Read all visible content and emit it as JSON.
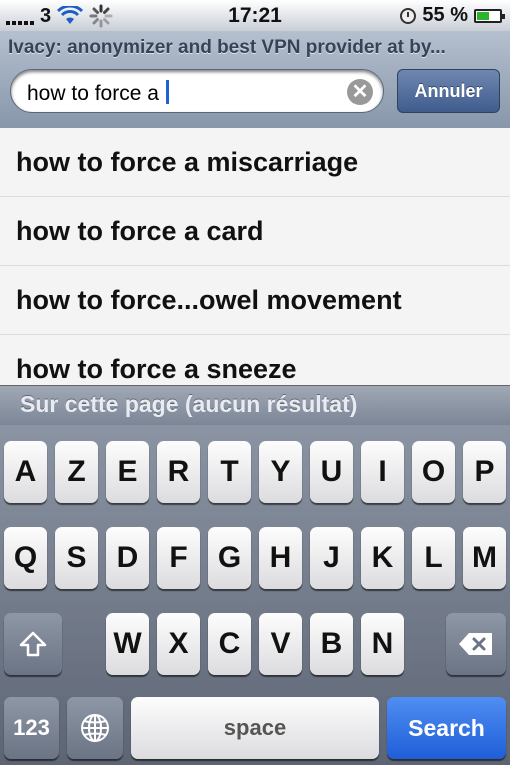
{
  "status_bar": {
    "carrier": "3",
    "time": "17:21",
    "battery_percent": "55 %",
    "battery_level": 0.55
  },
  "header": {
    "page_title": "Ivacy: anonymizer and best VPN provider at by...",
    "search_value": "how to force a",
    "cancel_label": "Annuler"
  },
  "suggestions": [
    "how to force a miscarriage",
    "how to force a card",
    "how to force...owel movement",
    "how to force a sneeze"
  ],
  "find_on_page": "Sur cette page (aucun résultat)",
  "keyboard": {
    "row1": [
      "A",
      "Z",
      "E",
      "R",
      "T",
      "Y",
      "U",
      "I",
      "O",
      "P"
    ],
    "row2": [
      "Q",
      "S",
      "D",
      "F",
      "G",
      "H",
      "J",
      "K",
      "L",
      "M"
    ],
    "row3": [
      "W",
      "X",
      "C",
      "V",
      "B",
      "N"
    ],
    "numbers_label": "123",
    "space_label": "space",
    "search_label": "Search"
  },
  "icons": [
    "signal-icon",
    "wifi-icon",
    "activity-spinner-icon",
    "clock-icon",
    "battery-icon",
    "clear-icon",
    "shift-icon",
    "globe-icon",
    "backspace-icon"
  ]
}
